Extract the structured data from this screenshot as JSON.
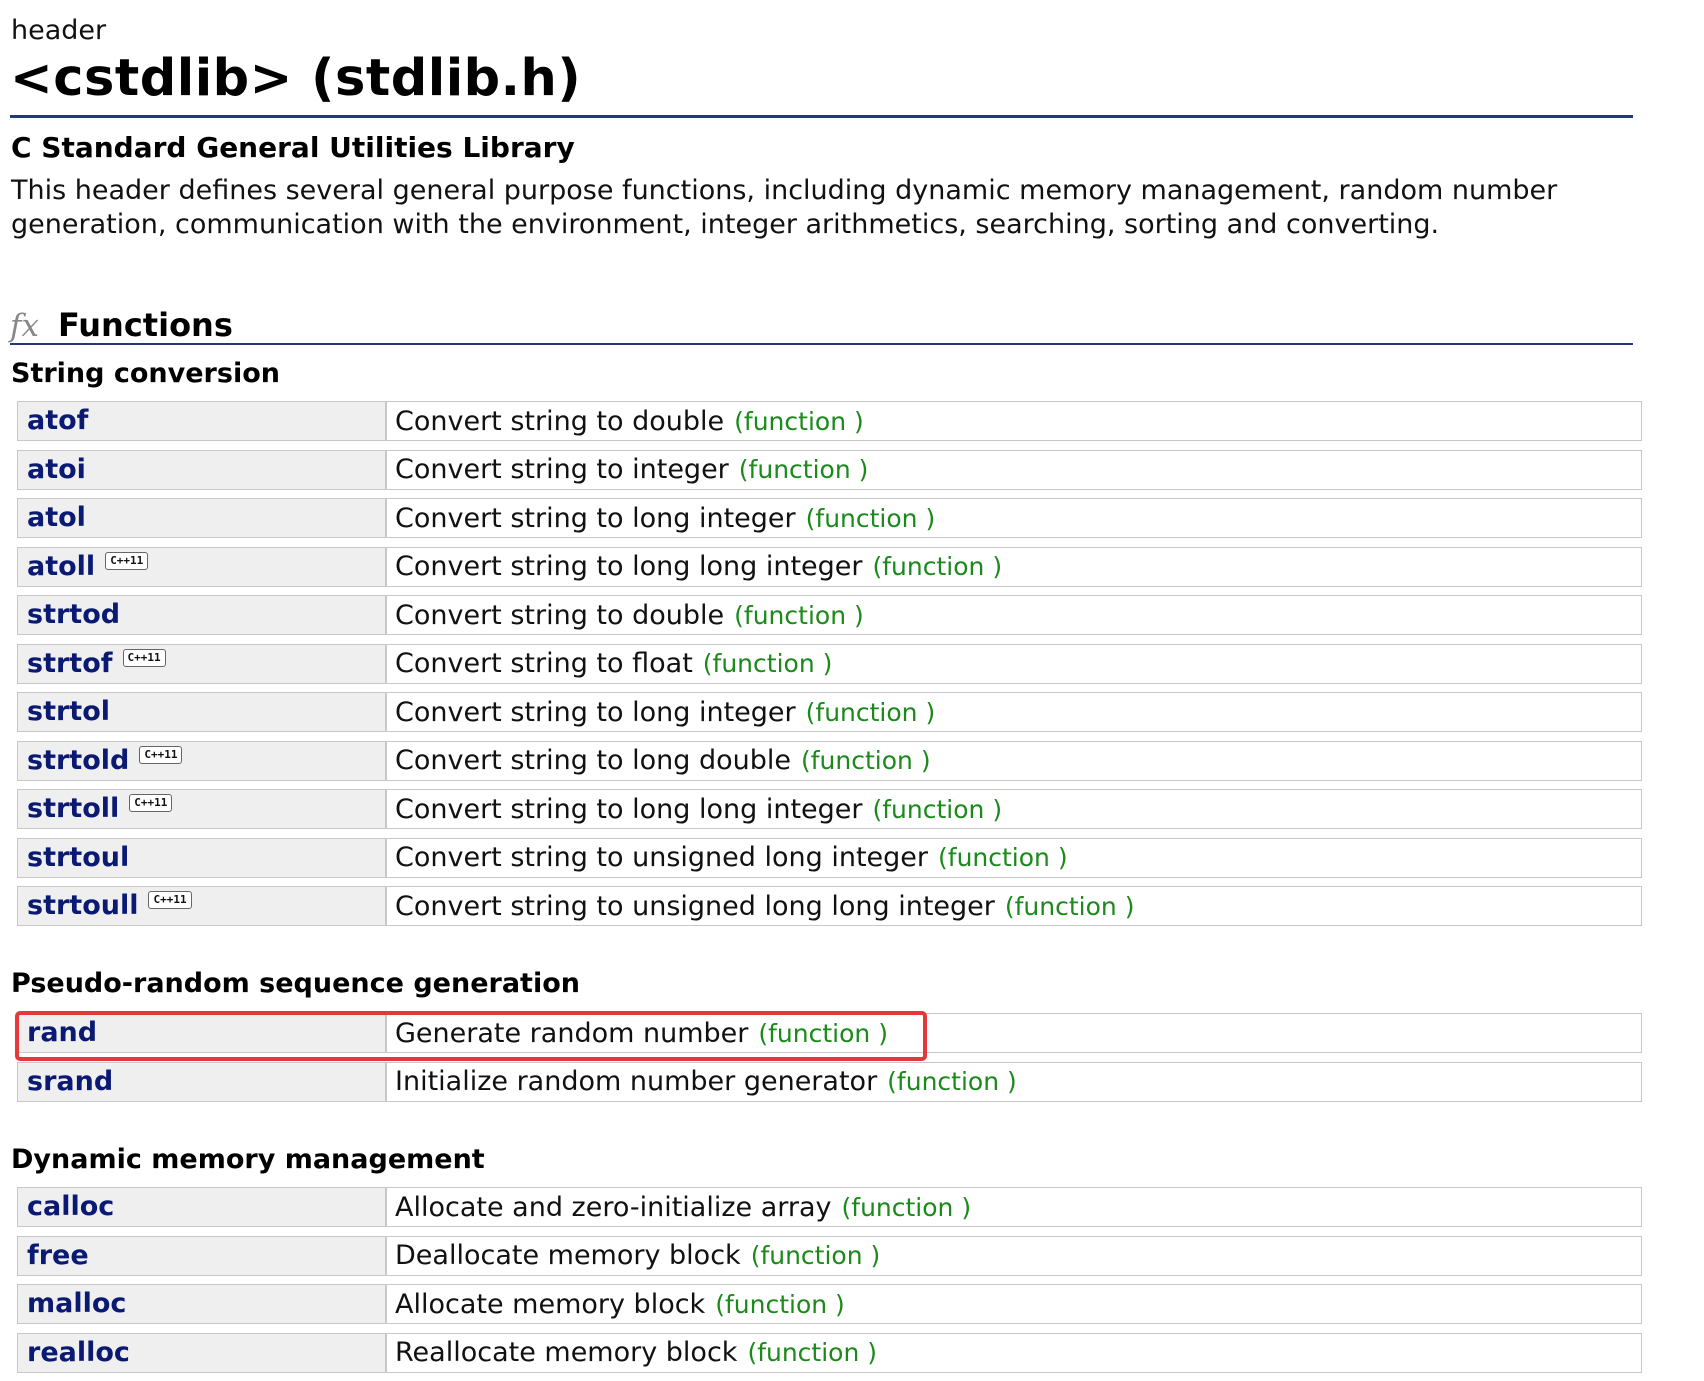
{
  "header": {
    "kind": "header",
    "title": "<cstdlib> (stdlib.h)",
    "subtitle": "C Standard General Utilities Library",
    "description": "This header defines several general purpose functions, including dynamic memory management, random number generation, communication with the environment, integer arithmetics, searching, sorting and converting."
  },
  "section": {
    "icon": "fx-icon",
    "icon_text": "fx",
    "title": "Functions"
  },
  "badge_text": "C++11",
  "groups": [
    {
      "title": "String conversion",
      "items": [
        {
          "name": "atof",
          "desc": "Convert string to double",
          "kind": "(function )",
          "cpp11": false
        },
        {
          "name": "atoi",
          "desc": "Convert string to integer",
          "kind": "(function )",
          "cpp11": false
        },
        {
          "name": "atol",
          "desc": "Convert string to long integer",
          "kind": "(function )",
          "cpp11": false
        },
        {
          "name": "atoll",
          "desc": "Convert string to long long integer",
          "kind": "(function )",
          "cpp11": true
        },
        {
          "name": "strtod",
          "desc": "Convert string to double",
          "kind": "(function )",
          "cpp11": false
        },
        {
          "name": "strtof",
          "desc": "Convert string to float",
          "kind": "(function )",
          "cpp11": true
        },
        {
          "name": "strtol",
          "desc": "Convert string to long integer",
          "kind": "(function )",
          "cpp11": false
        },
        {
          "name": "strtold",
          "desc": "Convert string to long double",
          "kind": "(function )",
          "cpp11": true
        },
        {
          "name": "strtoll",
          "desc": "Convert string to long long integer",
          "kind": "(function )",
          "cpp11": true
        },
        {
          "name": "strtoul",
          "desc": "Convert string to unsigned long integer",
          "kind": "(function )",
          "cpp11": false
        },
        {
          "name": "strtoull",
          "desc": "Convert string to unsigned long long integer",
          "kind": "(function )",
          "cpp11": true
        }
      ]
    },
    {
      "title": "Pseudo-random sequence generation",
      "items": [
        {
          "name": "rand",
          "desc": "Generate random number",
          "kind": "(function )",
          "cpp11": false,
          "highlighted": true
        },
        {
          "name": "srand",
          "desc": "Initialize random number generator",
          "kind": "(function )",
          "cpp11": false
        }
      ]
    },
    {
      "title": "Dynamic memory management",
      "items": [
        {
          "name": "calloc",
          "desc": "Allocate and zero-initialize array",
          "kind": "(function )",
          "cpp11": false
        },
        {
          "name": "free",
          "desc": "Deallocate memory block",
          "kind": "(function )",
          "cpp11": false
        },
        {
          "name": "malloc",
          "desc": "Allocate memory block",
          "kind": "(function )",
          "cpp11": false
        },
        {
          "name": "realloc",
          "desc": "Reallocate memory block",
          "kind": "(function )",
          "cpp11": false
        }
      ]
    }
  ],
  "colors": {
    "link": "#0a1a72",
    "kind": "#1b8a1b",
    "rule": "#1f3a7a",
    "highlight": "#e4383c"
  }
}
